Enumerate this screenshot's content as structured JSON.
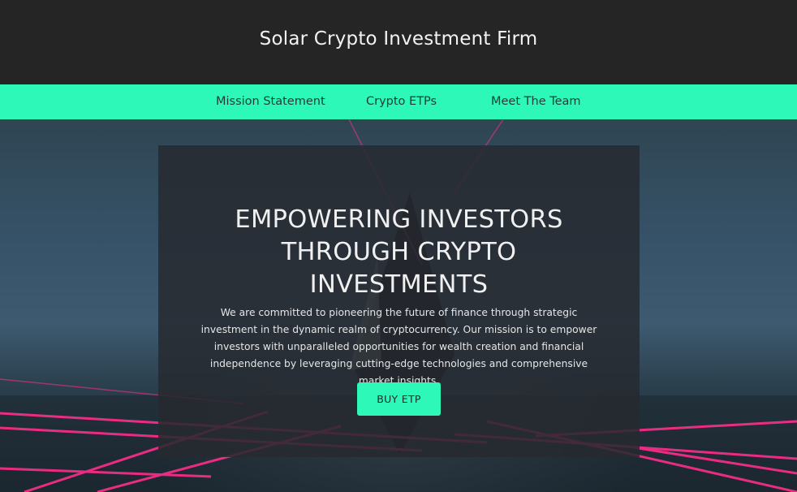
{
  "header": {
    "site_title": "Solar Crypto Investment Firm"
  },
  "nav": {
    "items": [
      {
        "label": "Mission Statement"
      },
      {
        "label": "Crypto ETPs"
      },
      {
        "label": "Meet The Team"
      }
    ]
  },
  "hero": {
    "headline_lines": [
      "EMPOWERING INVESTORS",
      "THROUGH CRYPTO",
      "INVESTMENTS"
    ],
    "description": "We are committed to pioneering the future of finance through strategic investment in the dynamic realm of cryptocurrency. Our mission is to empower investors with unparalleled opportunities for wealth creation and financial independence by leveraging cutting-edge technologies and comprehensive market insights.",
    "cta_label": "BUY ETP"
  },
  "colors": {
    "accent": "#2ef8b7",
    "header_bg": "#252525",
    "panel_bg": "#262a30",
    "laser": "#ff2d8a"
  }
}
